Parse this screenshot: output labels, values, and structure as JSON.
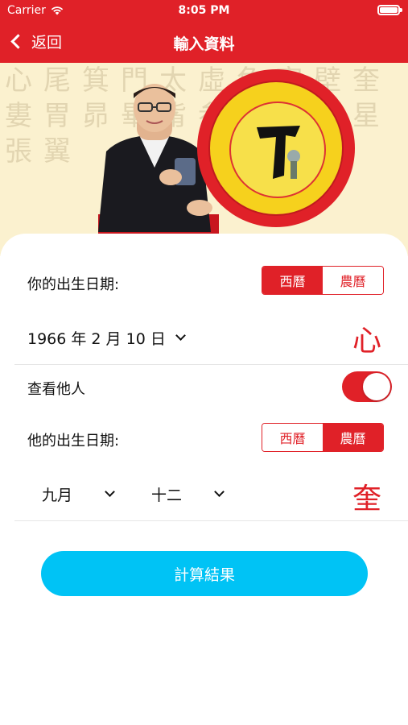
{
  "status_bar": {
    "carrier": "Carrier",
    "time": "8:05 PM"
  },
  "nav": {
    "back_label": "返回",
    "title": "輸入資料"
  },
  "banner": {
    "background_chars": "心尾箕門太虛危室壁奎婁胃昴畢觜参井鬼柳星張翼"
  },
  "birth": {
    "label": "你的出生日期:",
    "calendar_options": [
      "西曆",
      "農曆"
    ],
    "selected_calendar": "西曆",
    "date_value": "1966 年 2 月 10 日",
    "result_char": "心"
  },
  "others": {
    "label": "查看他人",
    "enabled": true
  },
  "other_birth": {
    "label": "他的出生日期:",
    "calendar_options": [
      "西曆",
      "農曆"
    ],
    "selected_calendar": "農曆",
    "month_value": "九月",
    "day_value": "十二",
    "result_char": "奎"
  },
  "actions": {
    "calculate_label": "計算結果"
  },
  "colors": {
    "primary_red": "#e02128",
    "button_blue": "#00c3f5",
    "banner_bg": "#fbf1cf"
  }
}
